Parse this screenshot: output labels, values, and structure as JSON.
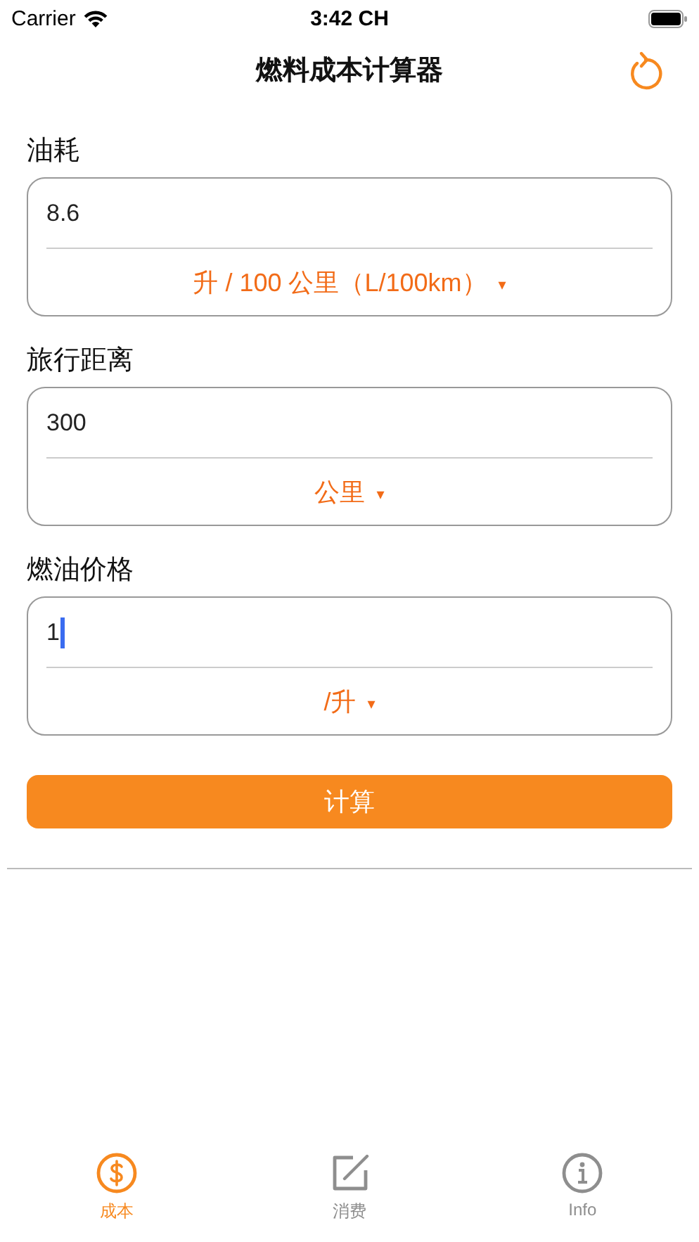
{
  "status_bar": {
    "carrier": "Carrier",
    "time": "3:42 CH"
  },
  "nav": {
    "title": "燃料成本计算器"
  },
  "fields": [
    {
      "label": "油耗",
      "value": "8.6",
      "unit": "升 / 100 公里（L/100km）",
      "caret": "▾",
      "focused": false
    },
    {
      "label": "旅行距离",
      "value": "300",
      "unit": "公里",
      "caret": "▾",
      "focused": false
    },
    {
      "label": "燃油价格",
      "value": "1",
      "unit": "/升",
      "caret": "▾",
      "focused": true
    }
  ],
  "calculate_button": "计算",
  "tabs": [
    {
      "label": "成本",
      "kind": "dollar",
      "selected": true
    },
    {
      "label": "消费",
      "kind": "edit",
      "selected": false
    },
    {
      "label": "Info",
      "kind": "info",
      "selected": false
    }
  ]
}
